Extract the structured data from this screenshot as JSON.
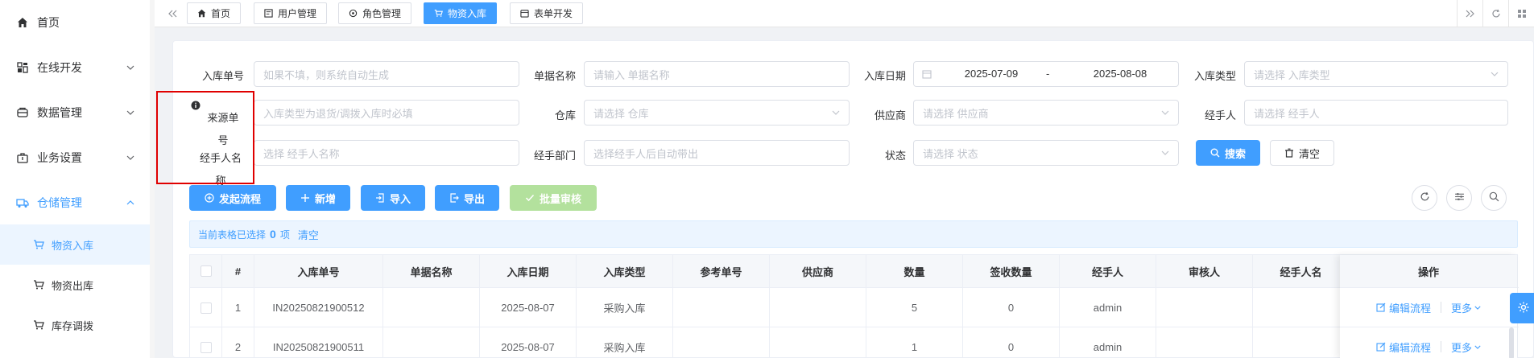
{
  "sidebar": {
    "items": [
      {
        "label": "首页",
        "icon": "home-icon"
      },
      {
        "label": "在线开发",
        "icon": "code-icon"
      },
      {
        "label": "数据管理",
        "icon": "database-icon"
      },
      {
        "label": "业务设置",
        "icon": "briefcase-icon"
      },
      {
        "label": "仓储管理",
        "icon": "truck-icon"
      }
    ],
    "subitems": [
      {
        "label": "物资入库",
        "icon": "cart-icon"
      },
      {
        "label": "物资出库",
        "icon": "cart-icon"
      },
      {
        "label": "库存调拨",
        "icon": "cart-icon"
      }
    ]
  },
  "tabs": [
    {
      "label": "首页",
      "icon": "home-icon"
    },
    {
      "label": "用户管理",
      "icon": "user-card-icon"
    },
    {
      "label": "角色管理",
      "icon": "role-icon"
    },
    {
      "label": "物资入库",
      "icon": "cart-icon"
    },
    {
      "label": "表单开发",
      "icon": "form-icon"
    }
  ],
  "form": {
    "rows": [
      [
        {
          "label": "入库单号",
          "placeholder": "如果不填，则系统自动生成"
        },
        {
          "label": "单据名称",
          "placeholder": "请输入 单据名称"
        },
        {
          "label": "入库日期",
          "start": "2025-07-09",
          "sep": "-",
          "end": "2025-08-08"
        },
        {
          "label": "入库类型",
          "placeholder": "请选择 入库类型"
        }
      ],
      [
        {
          "label_line1": "来源单",
          "label_line2": "号",
          "placeholder": "入库类型为退货/调拨入库时必填"
        },
        {
          "label": "仓库",
          "placeholder": "请选择 仓库"
        },
        {
          "label": "供应商",
          "placeholder": "请选择 供应商"
        },
        {
          "label": "经手人",
          "placeholder": "请选择 经手人"
        }
      ],
      [
        {
          "label_line1": "经手人名",
          "label_line2": "称",
          "placeholder": "选择 经手人名称"
        },
        {
          "label": "经手部门",
          "placeholder": "选择经手人后自动带出"
        },
        {
          "label": "状态",
          "placeholder": "请选择 状态"
        }
      ]
    ],
    "search_label": "搜索",
    "reset_label": "清空"
  },
  "toolbar": {
    "start_flow": "发起流程",
    "add": "新增",
    "import": "导入",
    "export": "导出",
    "batch_audit": "批量审核"
  },
  "selection": {
    "prefix": "当前表格已选择",
    "count": "0",
    "suffix": "项",
    "clear": "清空"
  },
  "table": {
    "headers": [
      "#",
      "入库单号",
      "单据名称",
      "入库日期",
      "入库类型",
      "参考单号",
      "供应商",
      "数量",
      "签收数量",
      "经手人",
      "审核人",
      "经手人名",
      "操作"
    ],
    "rows": [
      {
        "index": "1",
        "no": "IN20250821900512",
        "name": "",
        "date": "2025-08-07",
        "type": "采购入库",
        "ref": "",
        "supplier": "",
        "qty": "5",
        "signed": "0",
        "handler": "admin",
        "auditor": "",
        "handler_name": ""
      },
      {
        "index": "2",
        "no": "IN20250821900511",
        "name": "",
        "date": "2025-08-07",
        "type": "采购入库",
        "ref": "",
        "supplier": "",
        "qty": "1",
        "signed": "0",
        "handler": "admin",
        "auditor": "",
        "handler_name": ""
      }
    ],
    "edit_label": "编辑流程",
    "more_label": "更多"
  },
  "colors": {
    "primary": "#409eff",
    "success_disabled": "#b3e19d",
    "highlight": "#e00000"
  }
}
